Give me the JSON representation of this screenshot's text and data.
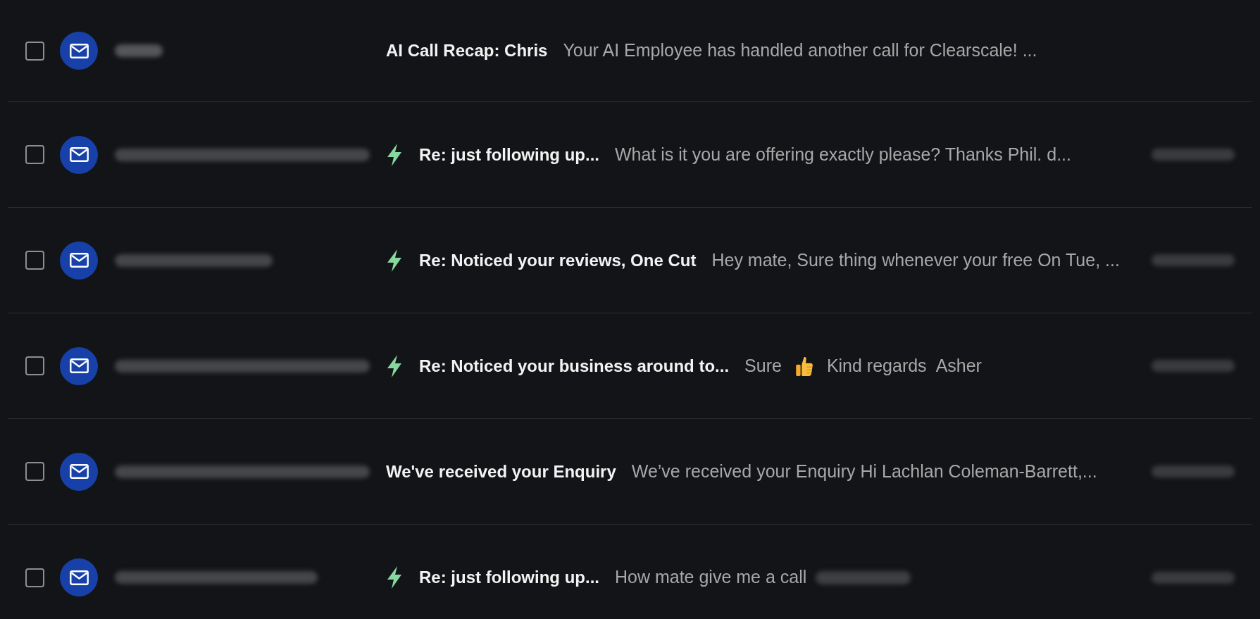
{
  "emails": [
    {
      "checked": false,
      "sender": {
        "kind": "short"
      },
      "marked": false,
      "subject": "AI Call Recap: Chris",
      "preview": [
        {
          "kind": "text",
          "text": "Your AI Employee has handled another call for Clearscale! ..."
        }
      ],
      "date_blurred": false
    },
    {
      "checked": false,
      "sender": {
        "kind": "full"
      },
      "marked": true,
      "subject": "Re: just following up...",
      "preview": [
        {
          "kind": "text",
          "text": "What is it you are offering exactly please? Thanks Phil. d..."
        }
      ],
      "date_blurred": true
    },
    {
      "checked": false,
      "sender": {
        "kind": "medium"
      },
      "marked": true,
      "subject": "Re: Noticed your reviews, One Cut",
      "preview": [
        {
          "kind": "text",
          "text": "Hey mate, Sure thing whenever your free On Tue, ..."
        }
      ],
      "date_blurred": true
    },
    {
      "checked": false,
      "sender": {
        "kind": "full"
      },
      "marked": true,
      "subject": "Re: Noticed your business around to...",
      "preview": [
        {
          "kind": "text",
          "text": "Sure"
        },
        {
          "kind": "emoji"
        },
        {
          "kind": "text",
          "text": "Kind regards"
        },
        {
          "kind": "text",
          "text": "Asher"
        }
      ],
      "date_blurred": true
    },
    {
      "checked": false,
      "sender": {
        "kind": "full"
      },
      "marked": false,
      "subject": "We've received your Enquiry",
      "preview": [
        {
          "kind": "text",
          "text": "We’ve received your Enquiry Hi Lachlan Coleman-Barrett,..."
        }
      ],
      "date_blurred": true
    },
    {
      "checked": false,
      "sender": {
        "kind": "long"
      },
      "marked": true,
      "subject": "Re: just following up...",
      "preview": [
        {
          "kind": "text",
          "text": "How mate give me a call"
        },
        {
          "kind": "redacted"
        }
      ],
      "date_blurred": true
    }
  ]
}
